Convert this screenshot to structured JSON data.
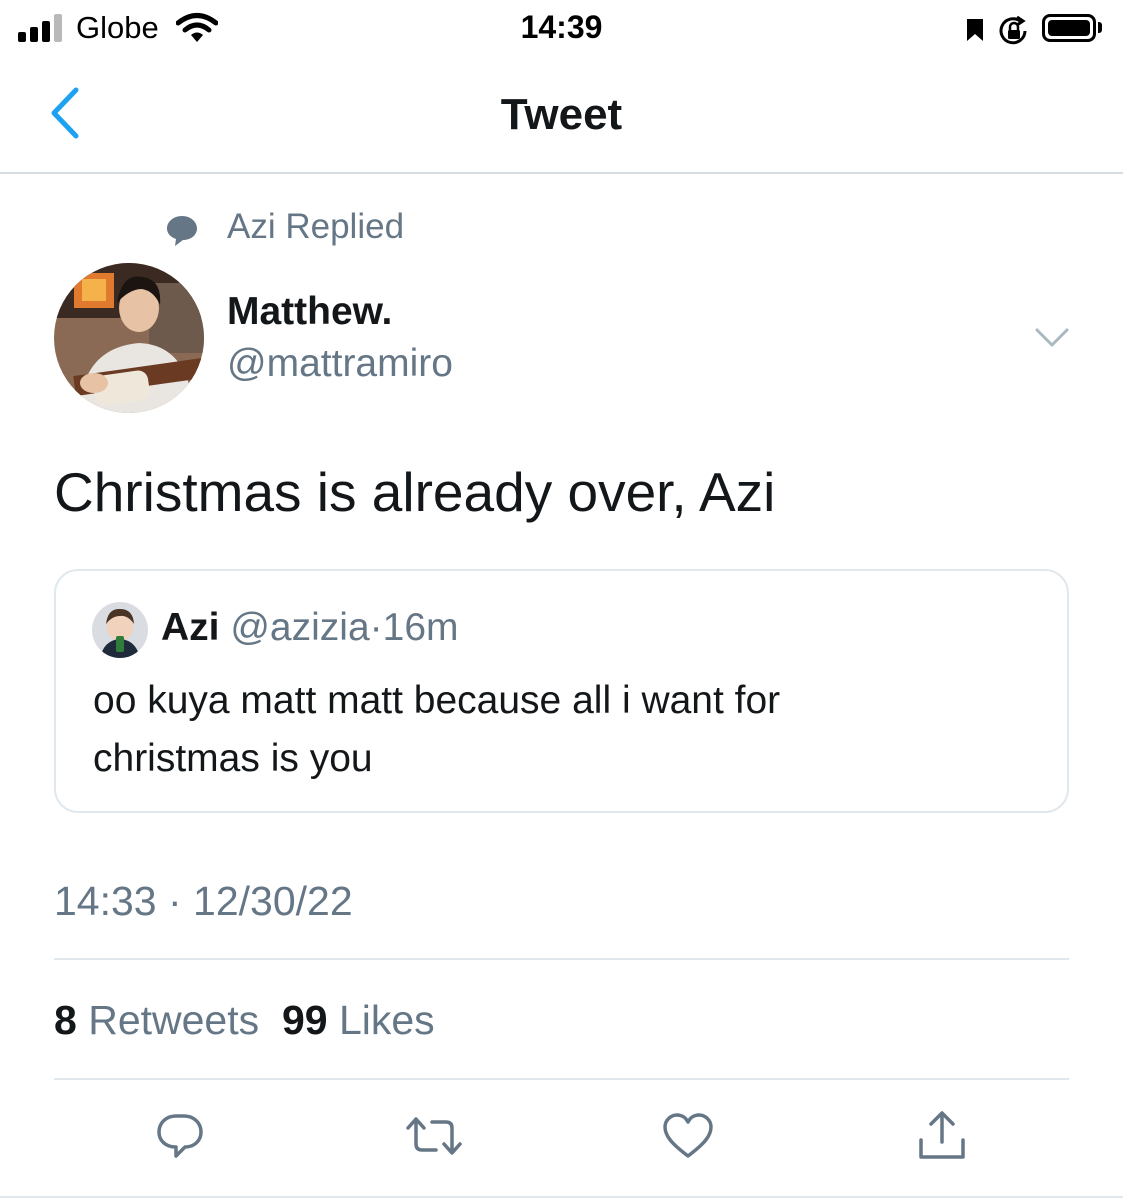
{
  "status_bar": {
    "carrier": "Globe",
    "time": "14:39",
    "signal_bars_active": 3,
    "signal_bars_total": 4,
    "battery_level": 1.0
  },
  "nav": {
    "title": "Tweet",
    "back_icon": "chevron-left-icon"
  },
  "social_context": {
    "icon": "speech-bubble-icon",
    "text": "Azi Replied"
  },
  "tweet": {
    "author": {
      "display_name": "Matthew.",
      "handle": "@mattramiro"
    },
    "text": "Christmas is already over, Azi",
    "quoted": {
      "display_name": "Azi",
      "handle": "@azizia",
      "separator": "·",
      "age": "16m",
      "text": "oo kuya matt matt because all i want for christmas is you"
    },
    "timestamp": "14:33 · 12/30/22",
    "stats": {
      "retweets_count": "8",
      "retweets_label": "Retweets",
      "likes_count": "99",
      "likes_label": "Likes"
    }
  },
  "actions": [
    "reply-icon",
    "retweet-icon",
    "like-icon",
    "share-icon"
  ],
  "colors": {
    "accent": "#1da1f2",
    "text_primary": "#14171a",
    "text_secondary": "#657786",
    "divider": "#e1e8ed"
  }
}
